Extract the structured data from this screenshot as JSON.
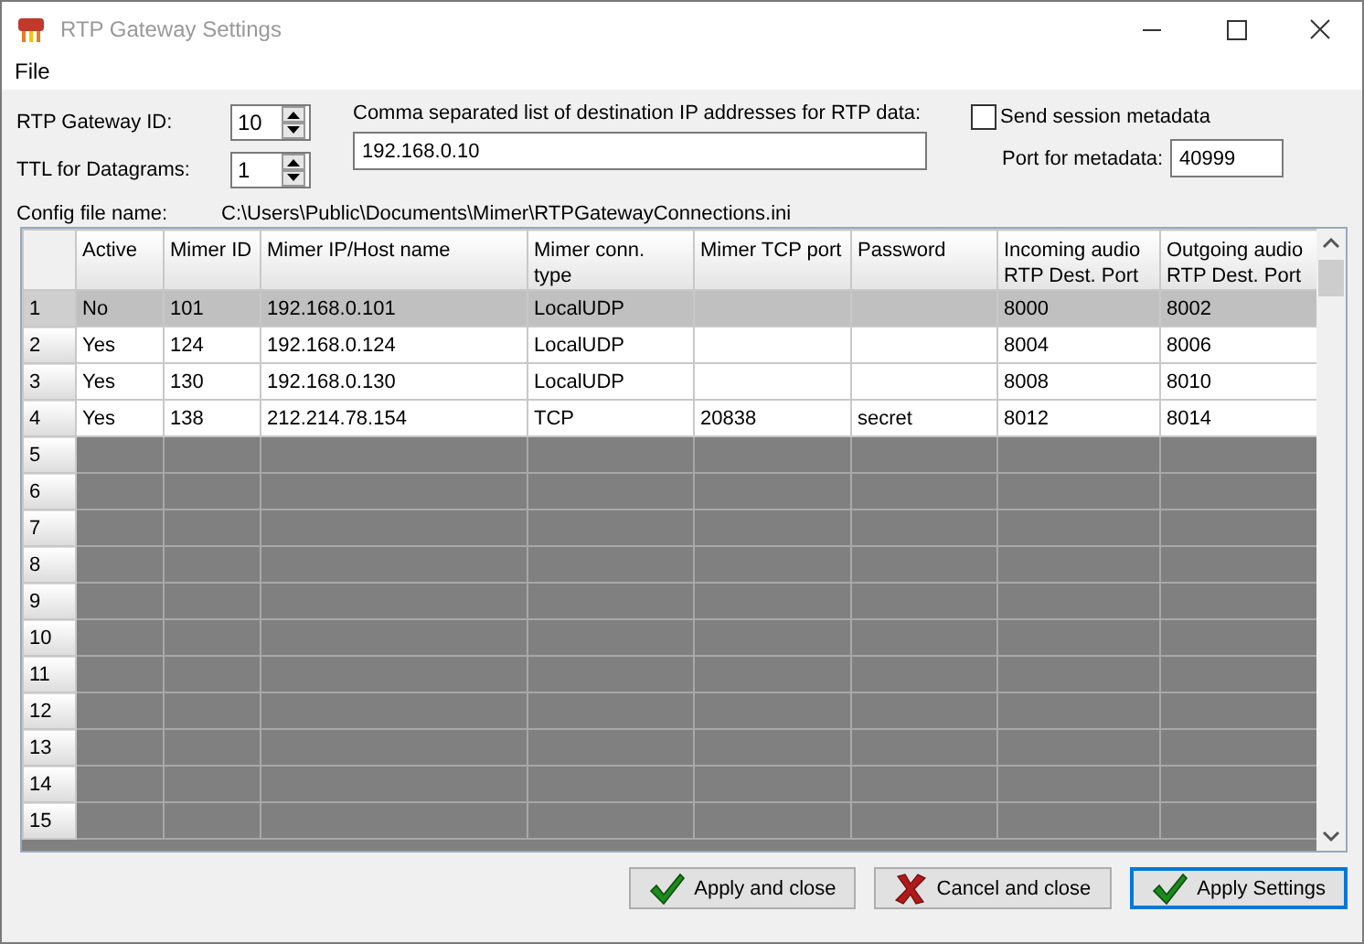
{
  "window": {
    "title": "RTP Gateway Settings"
  },
  "menu": [
    "File"
  ],
  "gateway_id": {
    "label": "RTP Gateway ID:",
    "value": "10"
  },
  "ttl": {
    "label": "TTL for Datagrams:",
    "value": "1"
  },
  "destinations": {
    "label": "Comma separated list of destination IP addresses for RTP data:",
    "value": "192.168.0.10"
  },
  "send_metadata": {
    "label": "Send session metadata",
    "checked": false
  },
  "metadata_port": {
    "label": "Port for metadata:",
    "value": "40999"
  },
  "config_file": {
    "label": "Config file name:",
    "value": "C:\\Users\\Public\\Documents\\Mimer\\RTPGatewayConnections.ini"
  },
  "table": {
    "columns": [
      "Active",
      "Mimer ID",
      "Mimer IP/Host name",
      "Mimer conn. type",
      "Mimer TCP port",
      "Password",
      "Incoming audio RTP Dest. Port",
      "Outgoing audio RTP Dest. Port"
    ],
    "rows": [
      {
        "number": "1",
        "selected": true,
        "cells": [
          "No",
          "101",
          "192.168.0.101",
          "LocalUDP",
          "",
          "",
          "8000",
          "8002"
        ]
      },
      {
        "number": "2",
        "selected": false,
        "cells": [
          "Yes",
          "124",
          "192.168.0.124",
          "LocalUDP",
          "",
          "",
          "8004",
          "8006"
        ]
      },
      {
        "number": "3",
        "selected": false,
        "cells": [
          "Yes",
          "130",
          "192.168.0.130",
          "LocalUDP",
          "",
          "",
          "8008",
          "8010"
        ]
      },
      {
        "number": "4",
        "selected": false,
        "cells": [
          "Yes",
          "138",
          "212.214.78.154",
          "TCP",
          "20838",
          "secret",
          "8012",
          "8014"
        ]
      },
      {
        "number": "5",
        "selected": false
      },
      {
        "number": "6",
        "selected": false
      },
      {
        "number": "7",
        "selected": false
      },
      {
        "number": "8",
        "selected": false
      },
      {
        "number": "9",
        "selected": false
      },
      {
        "number": "10",
        "selected": false
      },
      {
        "number": "11",
        "selected": false
      },
      {
        "number": "12",
        "selected": false
      },
      {
        "number": "13",
        "selected": false
      },
      {
        "number": "14",
        "selected": false
      },
      {
        "number": "15",
        "selected": false
      }
    ]
  },
  "buttons": [
    {
      "label": "Apply and close",
      "kind": "ok",
      "default": false
    },
    {
      "label": "Cancel and close",
      "kind": "cancel",
      "default": false
    },
    {
      "label": "Apply Settings",
      "kind": "ok",
      "default": true
    }
  ]
}
